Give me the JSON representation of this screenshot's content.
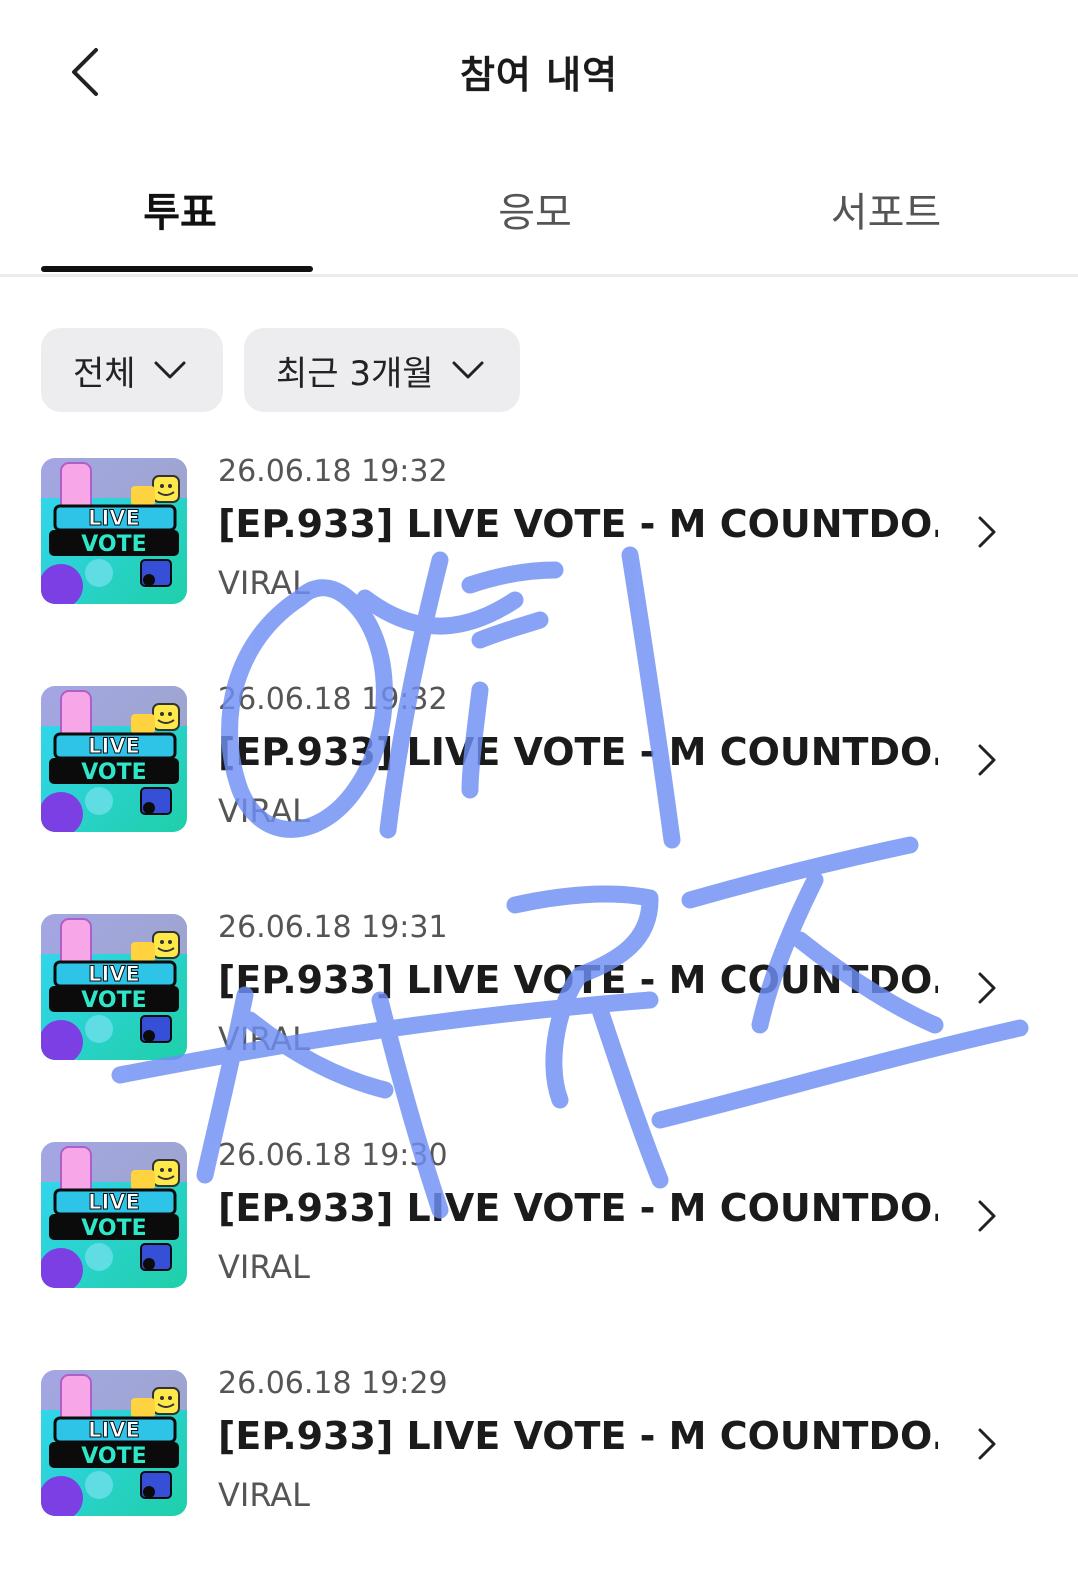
{
  "header": {
    "title": "참여 내역",
    "back_icon": "chevron-left-icon"
  },
  "tabs": [
    {
      "label": "투표",
      "active": true
    },
    {
      "label": "응모",
      "active": false
    },
    {
      "label": "서포트",
      "active": false
    }
  ],
  "filters": [
    {
      "label": "전체",
      "icon": "chevron-down-icon"
    },
    {
      "label": "최근 3개월",
      "icon": "chevron-down-icon"
    }
  ],
  "thumbnail": {
    "line1": "LIVE",
    "line2": "VOTE"
  },
  "items": [
    {
      "date": "26.06.18 19:32",
      "title": "[EP.933] LIVE VOTE - M COUNTDO...",
      "category": "VIRAL"
    },
    {
      "date": "26.06.18 19:32",
      "title": "[EP.933] LIVE VOTE - M COUNTDO...",
      "category": "VIRAL"
    },
    {
      "date": "26.06.18 19:31",
      "title": "[EP.933] LIVE VOTE - M COUNTDO...",
      "category": "VIRAL"
    },
    {
      "date": "26.06.18 19:30",
      "title": "[EP.933] LIVE VOTE - M COUNTDO...",
      "category": "VIRAL"
    },
    {
      "date": "26.06.18 19:29",
      "title": "[EP.933] LIVE VOTE - M COUNTDO...",
      "category": "VIRAL"
    }
  ],
  "watermark": {
    "text": "인티 서리즈",
    "color": "#6f8ff5"
  }
}
